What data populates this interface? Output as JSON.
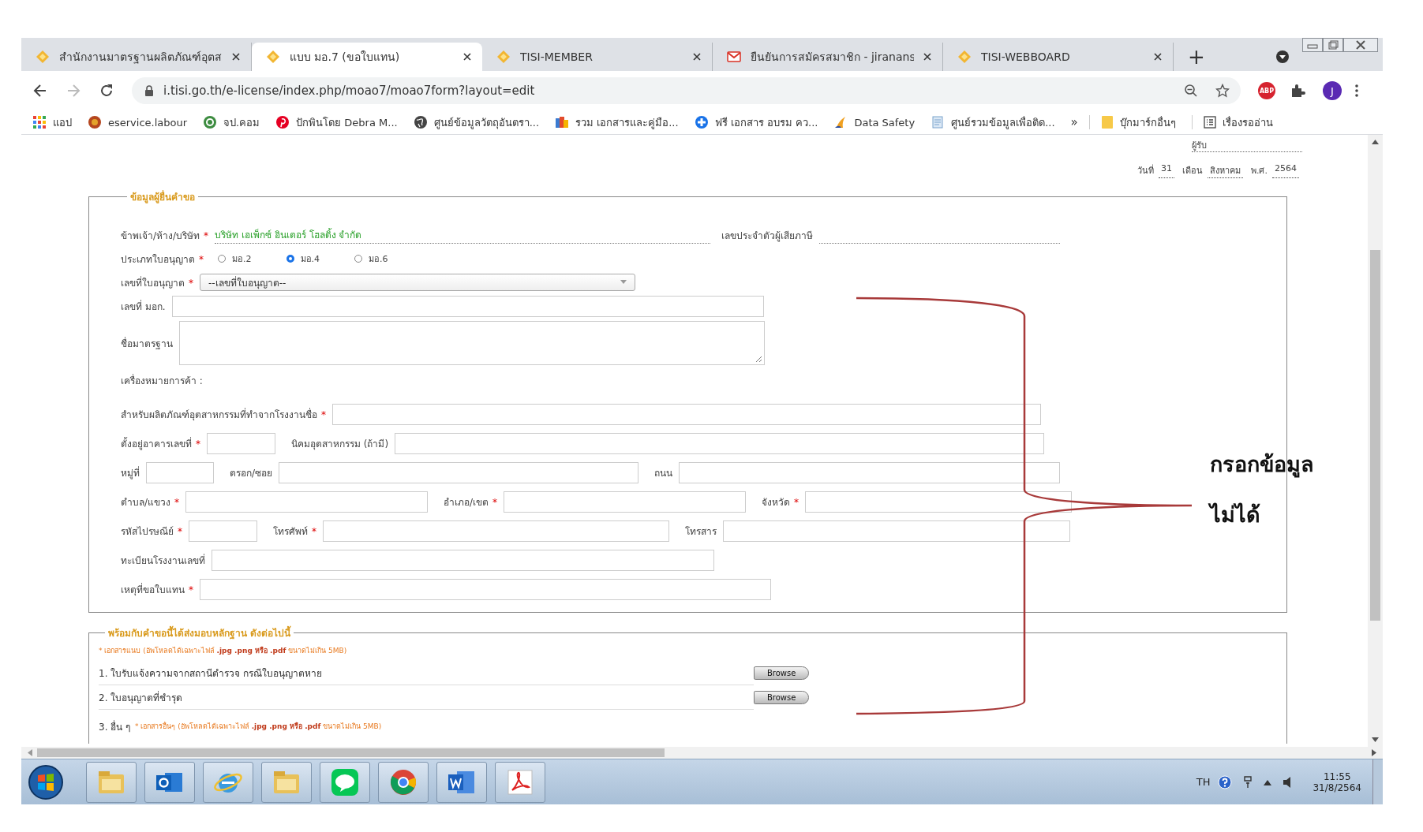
{
  "browser": {
    "tabs": [
      {
        "title": "สำนักงานมาตรฐานผลิตภัณฑ์อุตส",
        "selected": false
      },
      {
        "title": "แบบ มอ.7 (ขอใบแทน)",
        "selected": true
      },
      {
        "title": "TISI-MEMBER",
        "selected": false
      },
      {
        "title": "ยืนยันการสมัครสมาชิก - jiranans",
        "selected": false
      },
      {
        "title": "TISI-WEBBOARD",
        "selected": false
      }
    ],
    "new_tab": "+",
    "url": "i.tisi.go.th/e-license/index.php/moao7/moao7form?layout=edit",
    "adblock": "ABP",
    "profile_initial": "J",
    "bookmarks": [
      {
        "label": "แอป"
      },
      {
        "label": "eservice.labour"
      },
      {
        "label": "จป.คอม"
      },
      {
        "label": "ปักพินโดย Debra M..."
      },
      {
        "label": "ศูนย์ข้อมูลวัตถุอันตรา..."
      },
      {
        "label": "รวม เอกสารและคู่มือ..."
      },
      {
        "label": "ฟรี เอกสาร อบรม คว..."
      },
      {
        "label": "Data Safety"
      },
      {
        "label": "ศูนย์รวมข้อมูลเพื่อติด..."
      }
    ],
    "overflow": "»",
    "other_bookmarks": "บุ๊กมาร์กอื่นๆ",
    "reading_list": "เรื่องรออ่าน"
  },
  "page": {
    "receiver": "ผู้รับ",
    "date": [
      {
        "label": "วันที่",
        "value": "31"
      },
      {
        "label": "เดือน",
        "value": "สิงหาคม"
      },
      {
        "label": "พ.ศ.",
        "value": "2564"
      }
    ],
    "applicant_form": {
      "legend": "ข้อมูลผู้ยื่นคำขอ",
      "rows": [
        {
          "kind": "display",
          "parts": [
            {
              "label": "ข้าพเจ้า/ห้าง/บริษัท",
              "mark": "*",
              "value": "บริษัท เอเพ็กซ์ อินเตอร์ โฮลดิ้ง จำกัด"
            },
            {
              "label": "เลขประจำตัวผู้เสียภาษี"
            }
          ]
        },
        {
          "kind": "radio",
          "label": "ประเภทใบอนุญาต",
          "mark": "*",
          "options": [
            {
              "label": "มอ.2",
              "selected": false
            },
            {
              "label": "มอ.4",
              "selected": true
            },
            {
              "label": "มอ.6",
              "selected": false
            }
          ]
        },
        {
          "kind": "select",
          "label": "เลขที่ใบอนุญาต",
          "mark": "*",
          "placeholder": "--เลขที่ใบอนุญาต--"
        },
        {
          "kind": "fields",
          "parts": [
            {
              "label": "เลขที่ มอก."
            }
          ]
        },
        {
          "kind": "textarea",
          "label": "ชื่อมาตรฐาน"
        },
        {
          "kind": "plain",
          "label": "เครื่องหมายการค้า :"
        },
        {
          "kind": "fields",
          "parts": [
            {
              "label": "สำหรับผลิตภัณฑ์อุตสาหกรรมที่ทำจากโรงงานชื่อ",
              "mark": "*"
            }
          ]
        },
        {
          "kind": "fields",
          "parts": [
            {
              "label": "ตั้งอยู่อาคารเลขที่",
              "mark": "*"
            },
            {
              "label": "นิคมอุตสาหกรรม (ถ้ามี)"
            }
          ]
        },
        {
          "kind": "fields",
          "parts": [
            {
              "label": "หมู่ที่"
            },
            {
              "label": "ตรอก/ซอย"
            },
            {
              "label": "ถนน"
            }
          ]
        },
        {
          "kind": "fields",
          "parts": [
            {
              "label": "ตำบล/แขวง",
              "mark": "*"
            },
            {
              "label": "อำเภอ/เขต",
              "mark": "*"
            },
            {
              "label": "จังหวัด",
              "mark": "*"
            }
          ]
        },
        {
          "kind": "fields",
          "parts": [
            {
              "label": "รหัสไปรษณีย์",
              "mark": "*"
            },
            {
              "label": "โทรศัพท์",
              "mark": "*"
            },
            {
              "label": "โทรสาร"
            }
          ]
        },
        {
          "kind": "fields",
          "parts": [
            {
              "label": "ทะเบียนโรงงานเลขที่"
            }
          ]
        },
        {
          "kind": "fields",
          "parts": [
            {
              "label": "เหตุที่ขอใบแทน",
              "mark": "*"
            }
          ]
        }
      ]
    },
    "evidence": {
      "legend": "พร้อมกับคำขอนี้ได้ส่งมอบหลักฐาน ดังต่อไปนี้",
      "note": "* เอกสารแนบ (อัพโหลดได้เฉพาะไฟล์ **.jpg .png หรือ .pdf** ขนาดไม่เกิน 5MB)",
      "items": [
        {
          "text": "1. ใบรับแจ้งความจากสถานีตำรวจ กรณีใบอนุญาตหาย",
          "button": "Browse"
        },
        {
          "text": "2. ใบอนุญาตที่ชำรุด",
          "button": "Browse"
        }
      ],
      "other": {
        "label": "3. อื่น ๆ",
        "note": "* เอกสารอื่นๆ (อัพโหลดได้เฉพาะไฟล์ **.jpg .png หรือ .pdf** ขนาดไม่เกิน 5MB)"
      }
    }
  },
  "annotation": {
    "lines": [
      "กรอกข้อมูล",
      "ไม่ได้"
    ]
  },
  "taskbar": {
    "language": "TH",
    "time": "11:55",
    "date": "31/8/2564"
  }
}
